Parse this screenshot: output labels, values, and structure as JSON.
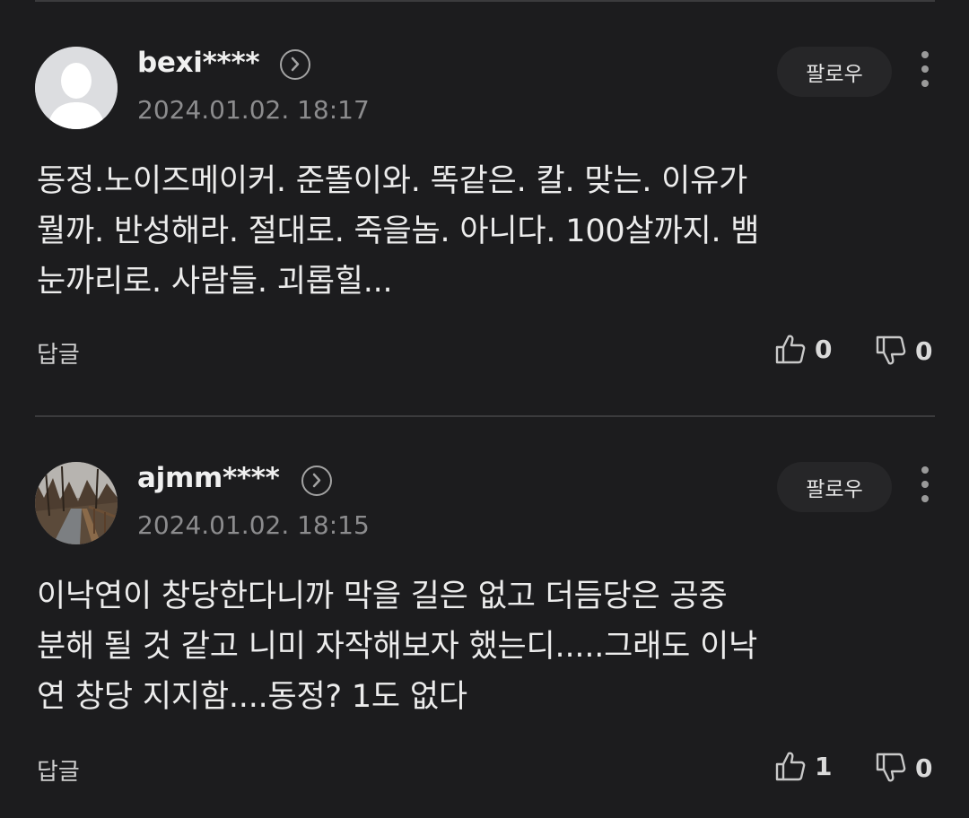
{
  "comments": [
    {
      "username": "bexi****",
      "timestamp": "2024.01.02. 18:17",
      "follow_label": "팔로우",
      "avatar": "default-user-avatar",
      "text": "동정.노이즈메이커. 준똘이와. 똑같은. 칼. 맞는. 이유가\n뭘까. 반성해라. 절대로. 죽을놈. 아니다. 100살까지. 뱀\n눈까리로. 사람들. 괴롭힐...",
      "reply_label": "답글",
      "likes": "0",
      "dislikes": "0"
    },
    {
      "username": "ajmm****",
      "timestamp": "2024.01.02. 18:15",
      "follow_label": "팔로우",
      "avatar": "photo-avatar-forest-path",
      "text": "이낙연이 창당한다니까 막을 길은 없고 더듬당은 공중\n분해 될 것 같고 니미 자작해보자 했는디.....그래도 이낙\n연 창당 지지함....동정? 1도 없다",
      "reply_label": "답글",
      "likes": "1",
      "dislikes": "0"
    }
  ],
  "icons": {
    "profile_link": "chevron-circle-icon",
    "more": "more-vertical-icon",
    "like": "thumbs-up-icon",
    "dislike": "thumbs-down-icon"
  },
  "colors": {
    "background": "#1c1c1e",
    "divider": "#3b3b3d",
    "follow_button_bg": "#262628",
    "timestamp": "#8c8c8e"
  }
}
